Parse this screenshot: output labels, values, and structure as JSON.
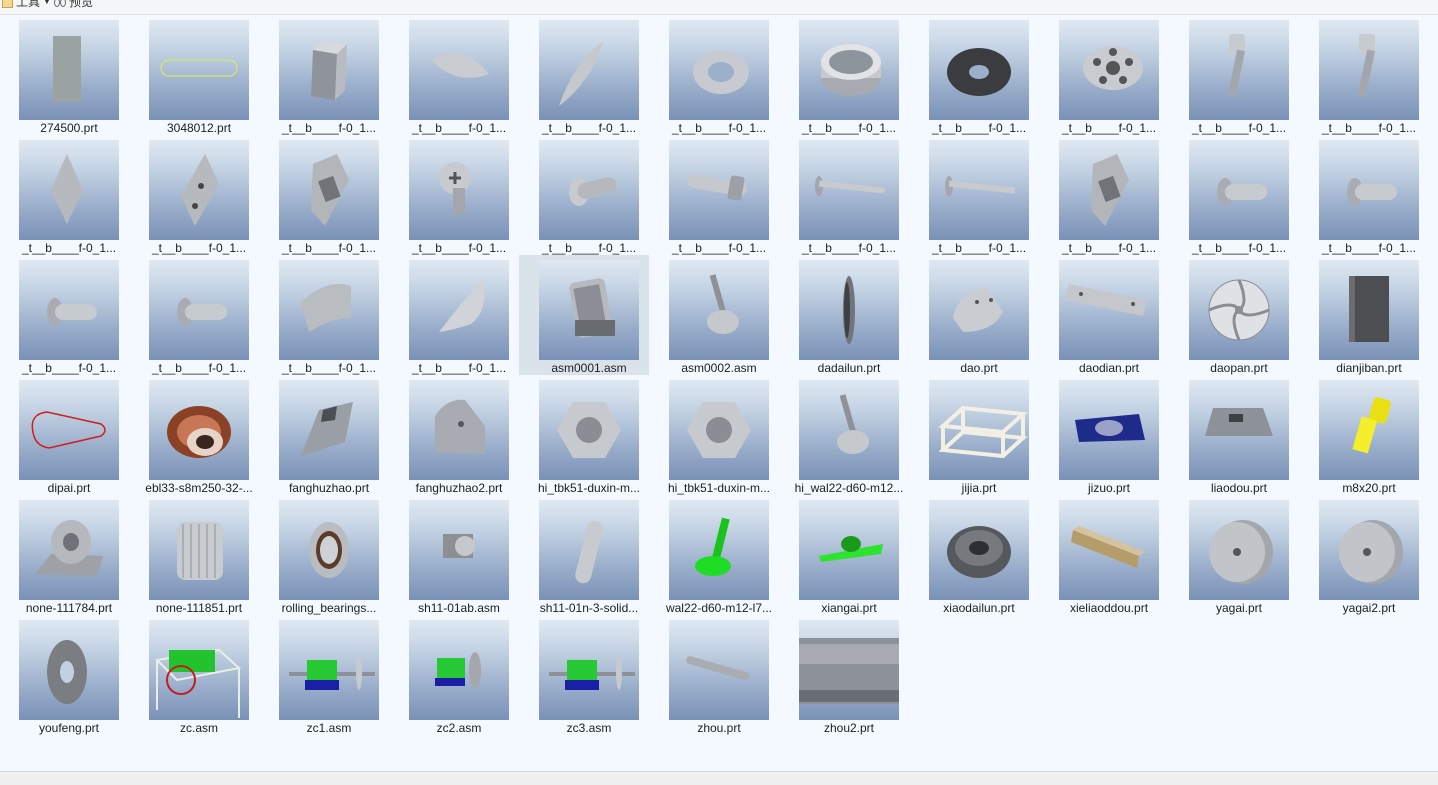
{
  "toolbar": {
    "tools_label": "工具",
    "preview_label": "预览"
  },
  "status": {
    "left": "",
    "right": ""
  },
  "files": [
    {
      "name": "274500.prt",
      "icon": "slab-icon"
    },
    {
      "name": "3048012.prt",
      "icon": "slot-outline-icon"
    },
    {
      "name": "_t__b____f-0_1...",
      "icon": "block-icon"
    },
    {
      "name": "_t__b____f-0_1...",
      "icon": "lens-icon"
    },
    {
      "name": "_t__b____f-0_1...",
      "icon": "leaf-blade-icon"
    },
    {
      "name": "_t__b____f-0_1...",
      "icon": "ring-icon"
    },
    {
      "name": "_t__b____f-0_1...",
      "icon": "drum-icon"
    },
    {
      "name": "_t__b____f-0_1...",
      "icon": "disk-plate-icon"
    },
    {
      "name": "_t__b____f-0_1...",
      "icon": "holed-disk-icon"
    },
    {
      "name": "_t__b____f-0_1...",
      "icon": "screw-icon"
    },
    {
      "name": "_t__b____f-0_1...",
      "icon": "screw-icon"
    },
    {
      "name": "_t__b____f-0_1...",
      "icon": "diamond-plate-icon"
    },
    {
      "name": "_t__b____f-0_1...",
      "icon": "diamond-plate-holes-icon"
    },
    {
      "name": "_t__b____f-0_1...",
      "icon": "frame-block-icon"
    },
    {
      "name": "_t__b____f-0_1...",
      "icon": "cross-bolt-icon"
    },
    {
      "name": "_t__b____f-0_1...",
      "icon": "pin-icon"
    },
    {
      "name": "_t__b____f-0_1...",
      "icon": "bolt-icon"
    },
    {
      "name": "_t__b____f-0_1...",
      "icon": "long-pin-icon"
    },
    {
      "name": "_t__b____f-0_1...",
      "icon": "long-pin-icon"
    },
    {
      "name": "_t__b____f-0_1...",
      "icon": "frame-block-icon"
    },
    {
      "name": "_t__b____f-0_1...",
      "icon": "rivet-icon"
    },
    {
      "name": "_t__b____f-0_1...",
      "icon": "rivet-icon"
    },
    {
      "name": "_t__b____f-0_1...",
      "icon": "rivet-icon"
    },
    {
      "name": "_t__b____f-0_1...",
      "icon": "rivet-icon"
    },
    {
      "name": "_t__b____f-0_1...",
      "icon": "curved-plate-icon"
    },
    {
      "name": "_t__b____f-0_1...",
      "icon": "curved-sheet-icon"
    },
    {
      "name": "asm0001.asm",
      "icon": "motor-assembly-icon"
    },
    {
      "name": "asm0002.asm",
      "icon": "leveling-foot-icon"
    },
    {
      "name": "dadailun.prt",
      "icon": "pulley-side-icon"
    },
    {
      "name": "dao.prt",
      "icon": "half-disk-icon"
    },
    {
      "name": "daodian.prt",
      "icon": "bar-plate-icon"
    },
    {
      "name": "daopan.prt",
      "icon": "blade-disk-icon"
    },
    {
      "name": "dianjiban.prt",
      "icon": "dark-plate-icon"
    },
    {
      "name": "dipai.prt",
      "icon": "belt-icon"
    },
    {
      "name": "ebl33-s8m250-32-...",
      "icon": "timing-pulley-icon"
    },
    {
      "name": "fanghuzhao.prt",
      "icon": "guard-icon"
    },
    {
      "name": "fanghuzhao2.prt",
      "icon": "guard-plate-icon"
    },
    {
      "name": "hi_tbk51-duxin-m...",
      "icon": "hex-nut-icon"
    },
    {
      "name": "hi_tbk51-duxin-m...",
      "icon": "hex-nut-icon"
    },
    {
      "name": "hi_wal22-d60-m12...",
      "icon": "leveling-foot-icon"
    },
    {
      "name": "jijia.prt",
      "icon": "frame-icon"
    },
    {
      "name": "jizuo.prt",
      "icon": "base-icon"
    },
    {
      "name": "liaodou.prt",
      "icon": "hopper-icon"
    },
    {
      "name": "m8x20.prt",
      "icon": "yellow-screw-icon"
    },
    {
      "name": "none-111784.prt",
      "icon": "bearing-block-icon"
    },
    {
      "name": "none-111851.prt",
      "icon": "motor-icon"
    },
    {
      "name": "rolling_bearings...",
      "icon": "bearing-icon"
    },
    {
      "name": "sh11-01ab.asm",
      "icon": "small-assembly-icon"
    },
    {
      "name": "sh11-01n-3-solid...",
      "icon": "key-icon"
    },
    {
      "name": "wal22-d60-m12-l7...",
      "icon": "green-foot-icon"
    },
    {
      "name": "xiangai.prt",
      "icon": "green-bracket-icon"
    },
    {
      "name": "xiaodailun.prt",
      "icon": "small-pulley-icon"
    },
    {
      "name": "xieliaoddou.prt",
      "icon": "chute-icon"
    },
    {
      "name": "yagai.prt",
      "icon": "cap-icon"
    },
    {
      "name": "yagai2.prt",
      "icon": "cap-icon"
    },
    {
      "name": "youfeng.prt",
      "icon": "seal-ring-icon"
    },
    {
      "name": "zc.asm",
      "icon": "machine-assembly-icon"
    },
    {
      "name": "zc1.asm",
      "icon": "shaft-assembly-icon"
    },
    {
      "name": "zc2.asm",
      "icon": "shaft-assembly-small-icon"
    },
    {
      "name": "zc3.asm",
      "icon": "shaft-assembly-icon"
    },
    {
      "name": "zhou.prt",
      "icon": "shaft-icon"
    },
    {
      "name": "zhou2.prt",
      "icon": "big-shaft-icon"
    }
  ],
  "selected_index": 26
}
